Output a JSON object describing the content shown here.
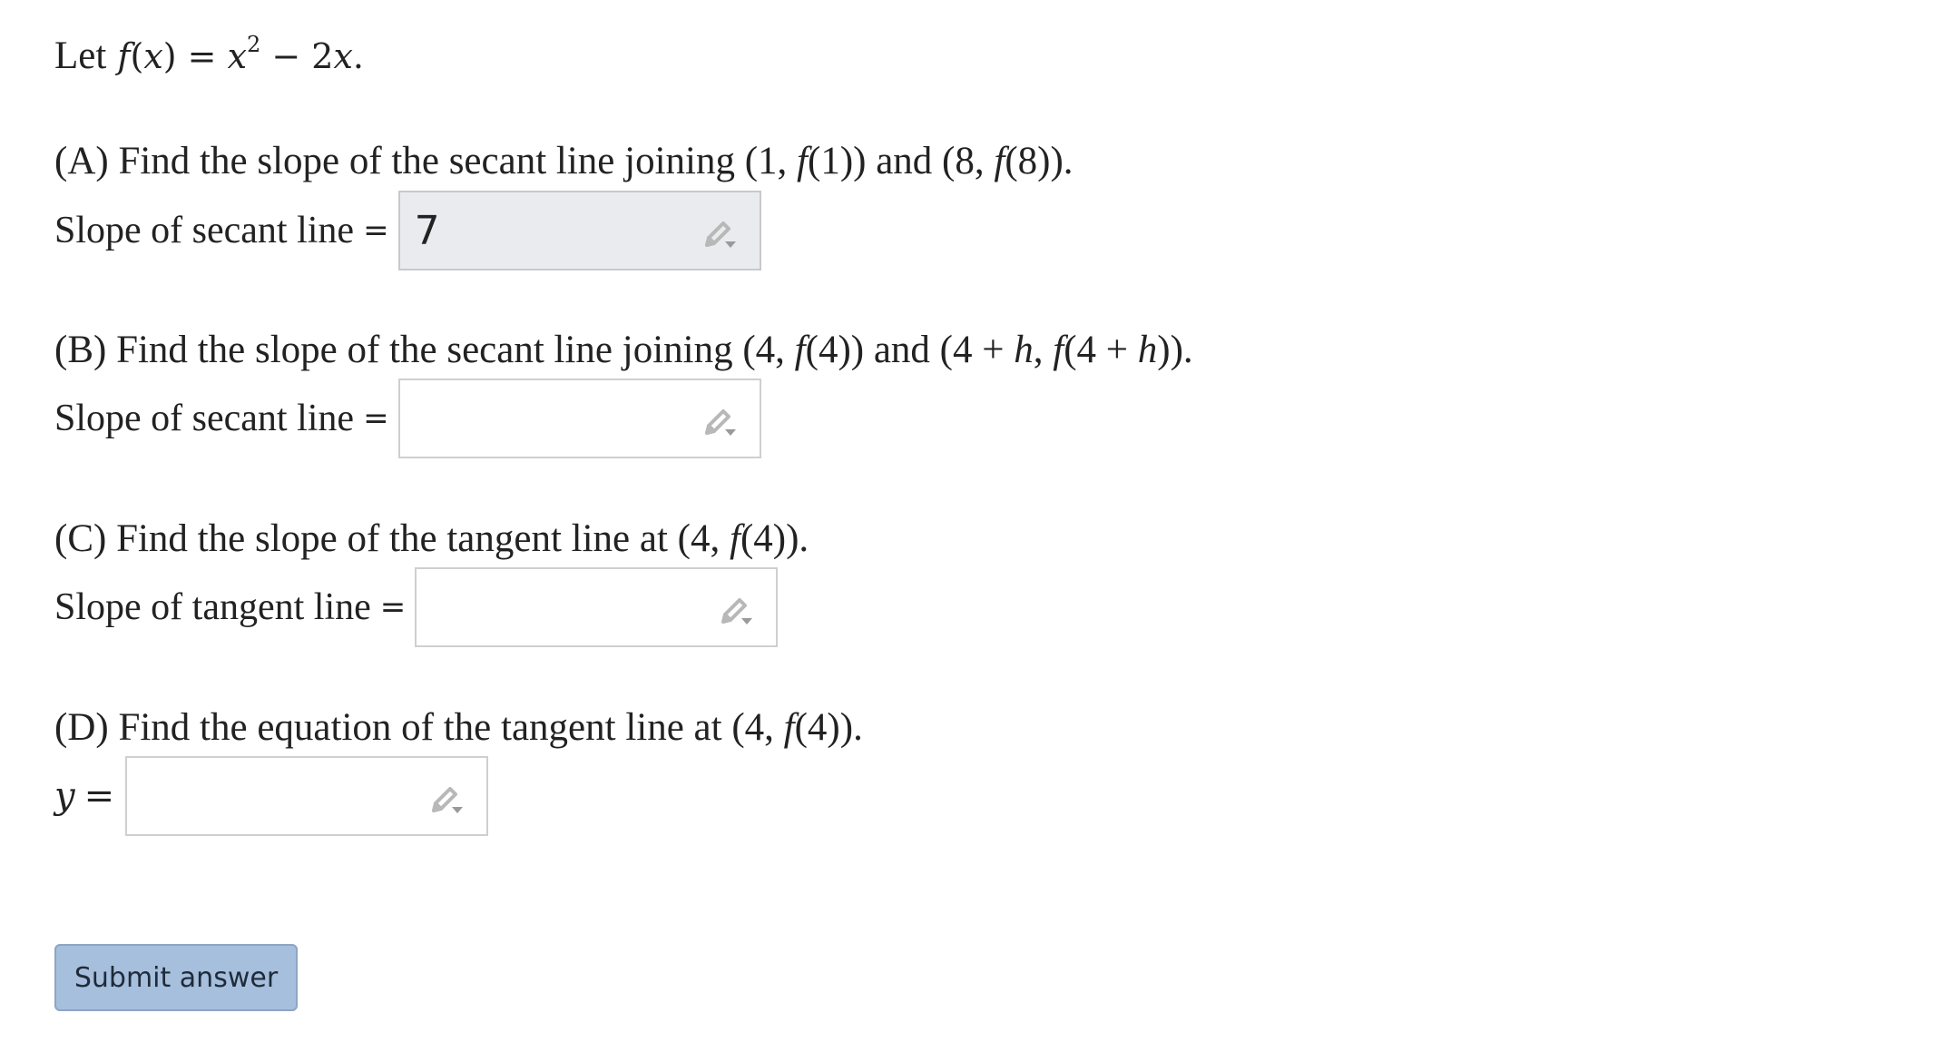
{
  "intro": {
    "let": "Let",
    "func": "f",
    "lparen": "(",
    "var": "x",
    "rparen": ")",
    "equals": " = ",
    "term1_var": "x",
    "exponent": "2",
    "minus": " − ",
    "term2": "2",
    "term2_var": "x",
    "period": "."
  },
  "parts": [
    {
      "question_prefix": "(A) Find the slope of the secant line joining ",
      "point1": "(1, ",
      "point1_f": "f",
      "point1_tail": "(1)) and (8, ",
      "point2_f": "f",
      "point2_tail": "(8)).",
      "label": "Slope of secant line",
      "equals": "=",
      "value": "7"
    },
    {
      "question_prefix": "(B) Find the slope of the secant line joining ",
      "point1": "(4, ",
      "point1_f": "f",
      "point1_tail": "(4)) and (4 + ",
      "h1": "h",
      "mid": ", ",
      "point2_f": "f",
      "point2_tail_a": "(4 + ",
      "h2": "h",
      "point2_tail_b": ")).",
      "label": "Slope of secant line",
      "equals": "=",
      "value": ""
    },
    {
      "question_prefix": "(C) Find the slope of the tangent line at ",
      "point1": "(4, ",
      "point1_f": "f",
      "point1_tail": "(4)).",
      "label": "Slope of tangent line",
      "equals": "=",
      "value": ""
    },
    {
      "question_prefix": "(D) Find the equation of the tangent line at ",
      "point1": "(4, ",
      "point1_f": "f",
      "point1_tail": "(4)).",
      "label_var": "y",
      "equals": "=",
      "value": ""
    }
  ],
  "submit_label": "Submit answer",
  "icons": {
    "answer_tool": "pencil-dropdown-icon"
  },
  "colors": {
    "filled_box_bg": "#eaebee",
    "submit_bg": "#a6bfdc"
  }
}
